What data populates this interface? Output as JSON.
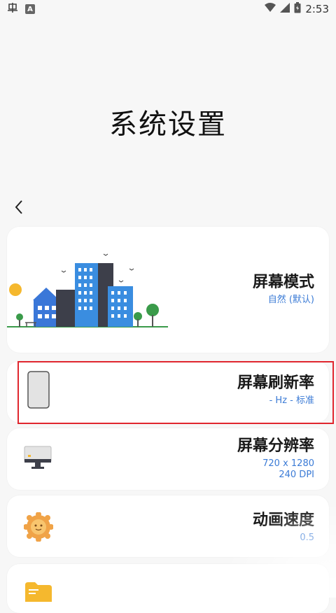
{
  "status_bar": {
    "carrier_icon_text": "A",
    "time": "2:53"
  },
  "page": {
    "title": "系统设置"
  },
  "items": [
    {
      "title": "屏幕模式",
      "subtitle": "自然 (默认)",
      "icon": "city-illustration"
    },
    {
      "title": "屏幕刷新率",
      "subtitle": "- Hz - 标准",
      "icon": "phone-icon"
    },
    {
      "title": "屏幕分辨率",
      "subtitle": "720 x 1280",
      "subtitle2": "240 DPI",
      "icon": "monitor-icon"
    },
    {
      "title": "动画速度",
      "subtitle": "0.5",
      "icon": "sun-icon"
    },
    {
      "title": "",
      "subtitle": "",
      "icon": "folder-icon"
    }
  ],
  "colors": {
    "accent": "#3b7bd6",
    "highlight": "#e0262e",
    "background": "#f7f7f7",
    "card": "#ffffff"
  }
}
